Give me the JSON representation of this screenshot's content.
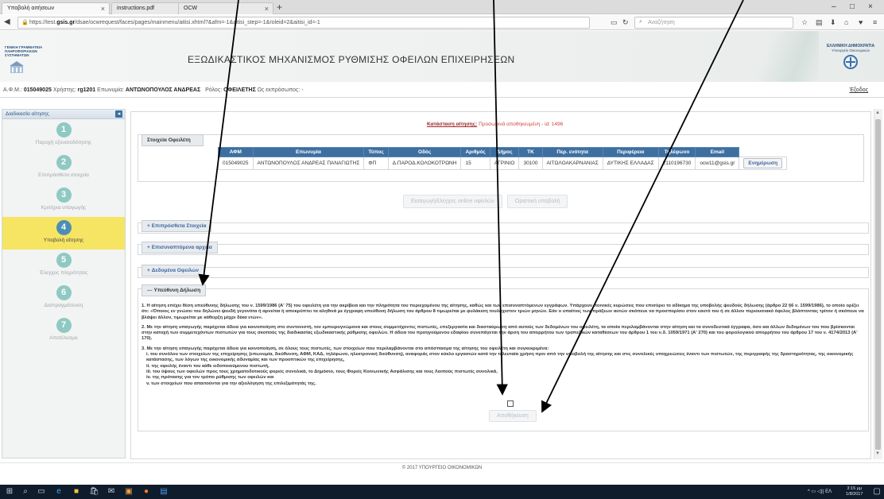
{
  "browser": {
    "tabs": [
      {
        "title": "Υποβολή αιτήσεων",
        "active": true
      },
      {
        "title": "instructions.pdf",
        "active": false
      },
      {
        "title": "OCW",
        "active": false
      }
    ],
    "url_prefix": "https://test.",
    "url_domain": "gsis.gr",
    "url_rest": "/dsae/ocwrequest/faces/pages/mainmenu/aitisi.xhtml?&afm=-1&aitisi_step=-1&roleid=2&aitisi_id=-1",
    "search_placeholder": "Αναζήτηση"
  },
  "header": {
    "left_logo_text": "ΓΕΝΙΚΗ ΓΡΑΜΜΑΤΕΙΑ ΠΛΗΡΟΦΟΡΙΑΚΩΝ ΣΥΣΤΗΜΑΤΩΝ",
    "title": "ΕΞΩΔΙΚΑΣΤΙΚΟΣ ΜΗΧΑΝΙΣΜΟΣ ΡΥΘΜΙΣΗΣ ΟΦΕΙΛΩΝ ΕΠΙΧΕΙΡΗΣΕΩΝ",
    "right_logo_line1": "ΕΛΛΗΝΙΚΗ ΔΗΜΟΚΡΑΤΙΑ",
    "right_logo_line2": "Υπουργείο Οικονομικών"
  },
  "userbar": {
    "afm_label": "Α.Φ.Μ.:",
    "afm_value": "015049025",
    "user_label": "Χρήστης:",
    "user_value": "rg1201",
    "name_label": "Επωνυμία:",
    "name_value": "ΑΝΤΩΝΟΠΟΥΛΟΣ ΑΝΔΡΕΑΣ",
    "role_label": "Ρόλος:",
    "role_value": "ΟΦΕΙΛΕΤΗΣ",
    "rep_label": "Ως εκπρόσωπος:",
    "rep_value": "-",
    "logout": "Έξοδος"
  },
  "sidebar": {
    "title": "Διαδικασία αίτησης",
    "collapse": "◂",
    "steps": [
      {
        "num": "1",
        "label": "Παροχή εξουσιοδότησης",
        "active": false
      },
      {
        "num": "2",
        "label": "Επιπρόσθετα στοιχεία",
        "active": false
      },
      {
        "num": "3",
        "label": "Κριτήρια υπαγωγής",
        "active": false
      },
      {
        "num": "4",
        "label": "Υποβολή αίτησης",
        "active": true
      },
      {
        "num": "5",
        "label": "Έλεγχος πληρότητας",
        "active": false
      },
      {
        "num": "6",
        "label": "Διαπραγμάτευση",
        "active": false
      },
      {
        "num": "7",
        "label": "Αποτέλεσμα",
        "active": false
      }
    ]
  },
  "main": {
    "status_label": "Κατάσταση αίτησης:",
    "status_value": "Προσωρινά αποθηκευμένη - id: 1496",
    "debtor": {
      "legend": "Στοιχεία Οφειλέτη",
      "headers": [
        "ΑΦΜ",
        "Επωνυμία",
        "Τύπος",
        "Οδός",
        "Αριθμός",
        "Δήμος",
        "ΤΚ",
        "Περ. ενότητα",
        "Περιφέρεια",
        "Τηλέφωνο",
        "Email"
      ],
      "row": [
        "015049025",
        "ΑΝΤΩΝΟΠΟΥΛΟΣ ΑΝΔΡΕΑΣ ΠΑΝΑΓΙΩΤΗΣ",
        "ΦΠ",
        "Δ.ΠΑΡΟΔ.ΚΟΛΟΚΟΤΡΩΝΗ",
        "15",
        "ΑΓΡΙΝΙΟ",
        "30100",
        "ΑΙΤΩΛΟΑΚΑΡΝΑΝΙΑΣ",
        "ΔΥΤΙΚΗΣ ΕΛΛΑΔΑΣ",
        "2110196730",
        "ocw11@gsis.gr"
      ],
      "update_label": "Ενημέρωση"
    },
    "import_btn": "Εισαγωγή/έλεγχος online οφειλών",
    "final_btn": "Οριστική υποβολή",
    "panels": [
      {
        "sign": "+",
        "label": "Επιπρόσθετα Στοιχεία"
      },
      {
        "sign": "+",
        "label": "Επισυναπτόμενα αρχεία"
      },
      {
        "sign": "+",
        "label": "Δεδομένα Οφειλών"
      }
    ],
    "declaration": {
      "sign": "—",
      "legend": "Υπεύθυνη Δήλωση",
      "p1": "1. Η αίτηση επέχει θέση υπεύθυνης δήλωσης του ν. 1599/1986 (Α' 75) του οφειλέτη για την ακρίβεια και την πληρότητα του περιεχομένου της αίτησης, καθώς και των επισυναπτόμενων εγγράφων. Υπάρχουν ποινικές κυρώσεις που επισύρει το αδίκημα της υποβολής ψευδούς δήλωσης (άρθρο 22 §6 ν. 1599/1986), το οποίο ορίζει ότι: «Όποιος εν γνώσει του δηλώνει ψευδή γεγονότα ή αρνείται ή αποκρύπτει τα αληθινά με έγγραφη υπεύθυνη δήλωση του άρθρου 8 τιμωρείται με φυλάκιση τουλάχιστον τριών μηνών. Εάν ο υπαίτιος των πράξεων αυτών σκόπευε να προσπορίσει στον εαυτό του ή σε άλλον περιουσιακό όφελος βλάπτοντας τρίτον ή σκόπευε να βλάψει άλλον, τιμωρείται με κάθειρξη μέχρι δέκα ετών».",
      "p2": "2. Με την αίτηση υπαγωγής παρέχεται άδεια για κοινοποίηση στο συντονιστή, τον εμπειρογνώμονα και στους συμμετέχοντες πιστωτές, επεξεργασία και διασταύρωση από αυτούς των δεδομένων του οφειλέτη, τα οποία περιλαμβάνονται στην αίτηση και τα συνοδευτικά έγγραφα, όσο και άλλων δεδομένων του που βρίσκονται στην κατοχή των συμμετεχόντων πιστωτών για τους σκοπούς της διαδικασίας εξωδικαστικής ρύθμισης οφειλών. Η άδεια του προηγούμενου εδαφίου συνεπάγεται την άρση του απορρήτου των τραπεζικών καταθέσεων του άρθρου 1 του ν.δ. 1059/1971 (Α' 270) και του φορολογικού απορρήτου του άρθρου 17 του ν. 4174/2013 (Α' 170).",
      "p3": "3. Με την αίτηση υπαγωγής παρέχεται άδεια για κοινοποίηση, σε όλους τους πιστωτές, των στοιχείων που περιλαμβάνονται στο απόσπασμα της αίτησης του οφειλέτη και συγκεκριμένα:",
      "items": [
        "i. του συνόλου των στοιχείων της επιχείρησης (επωνυμία, διεύθυνση, ΑΦΜ, ΚΑΔ, τηλέφωνο, ηλεκτρονική διεύθυνση), αναφοράς στον κύκλο εργασιών κατά την τελευταία χρήση πριν από την υποβολή της αίτησης και στις συνολικές υποχρεώσεις έναντι των πιστωτών, της περιγραφής της δραστηριότητας, της οικονομικής κατάστασης, των λόγων της οικονομικής αδυναμίας και των προοπτικών της επιχείρησης,",
        "ii. της οφειλής έναντι του κάθε ειδοποιούμενου πιστωτή,",
        "iii. του ύψους των οφειλών προς τους χρηματοδοτικούς φορείς συνολικά, το Δημόσιο, τους Φορείς Κοινωνικής Ασφάλισης και τους Λοιπούς πιστωτές συνολικά,",
        "iv. της πρότασης για τον τρόπο ρύθμισης των οφειλών και",
        "v. των στοιχείων που απαιτούνται για την αξιολόγηση της επιλεξιμότητάς της."
      ],
      "submit": "Αποθήκευση"
    }
  },
  "footer": "© 2017 ΥΠΟΥΡΓΕΙΟ ΟΙΚΟΝΟΜΙΚΩΝ",
  "taskbar": {
    "lang": "ΕΛ",
    "time": "3:15 μμ",
    "date": "1/8/2017"
  }
}
